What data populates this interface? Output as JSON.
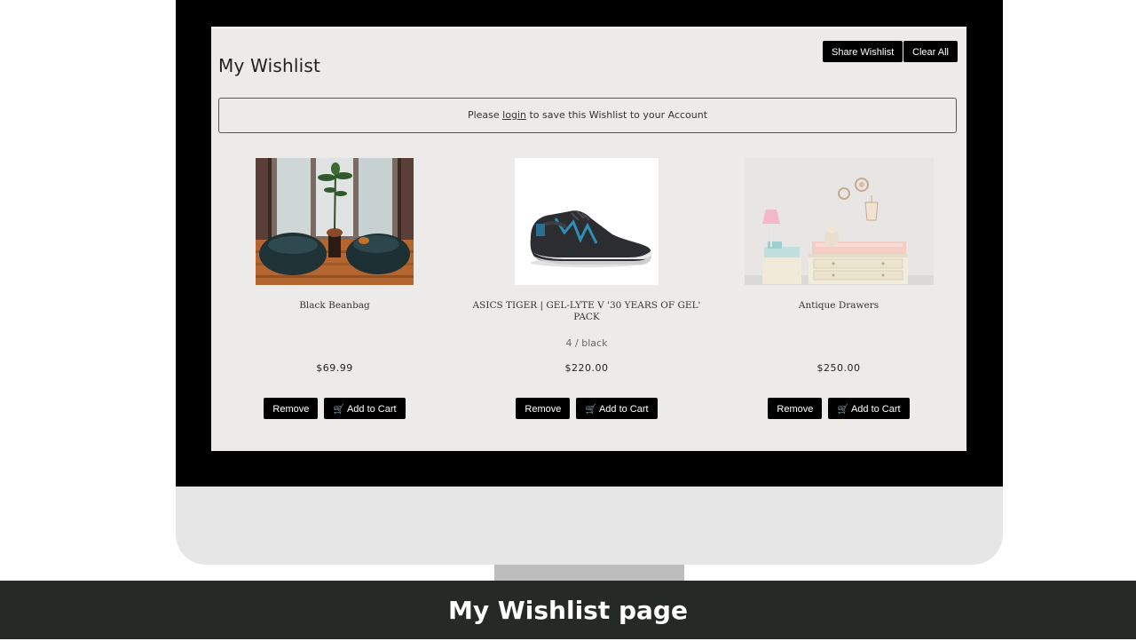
{
  "wishlist": {
    "title": "My Wishlist",
    "share_label": "Share Wishlist",
    "clear_label": "Clear All",
    "notice": {
      "prefix": "Please",
      "link": "login",
      "suffix": "to save this Wishlist to your Account"
    },
    "products": [
      {
        "name": "Black Beanbag",
        "variant": "",
        "price": "$69.99",
        "remove_label": "Remove",
        "cart_label": "Add to Cart",
        "image": "beanbag-photo"
      },
      {
        "name": "ASICS TIGER | GEL-LYTE V '30 YEARS OF GEL' PACK",
        "variant": "4 / black",
        "price": "$220.00",
        "remove_label": "Remove",
        "cart_label": "Add to Cart",
        "image": "sneaker-photo"
      },
      {
        "name": "Antique Drawers",
        "variant": "",
        "price": "$250.00",
        "remove_label": "Remove",
        "cart_label": "Add to Cart",
        "image": "drawers-photo"
      }
    ]
  },
  "caption": "My Wishlist page",
  "colors": {
    "screen_bg": "#ecebe9",
    "button_bg": "#000000",
    "caption_bg": "#252a27"
  }
}
